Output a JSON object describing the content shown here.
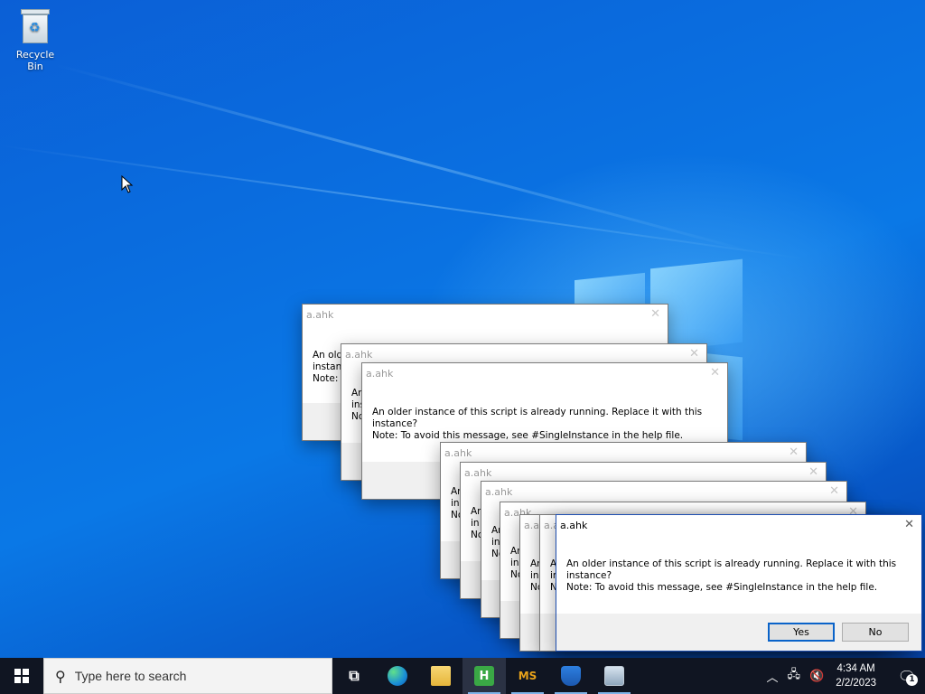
{
  "desktop": {
    "icons": [
      {
        "label": "Recycle Bin",
        "icon": "recycle-bin-icon"
      }
    ]
  },
  "dialog": {
    "title": "a.ahk",
    "message_line1": "An older instance of this script is already running.  Replace it with this instance?",
    "message_line2": "Note: To avoid this message, see #SingleInstance in the help file.",
    "yes_label": "Yes",
    "no_label": "No",
    "partial_line1": "An older",
    "partial_line2": "instan",
    "partial_line3": "Note:",
    "clip_a": "An",
    "clip_b": "ins",
    "clip_c": "No",
    "clip_d": "in"
  },
  "taskbar": {
    "search_placeholder": "Type here to search",
    "apps": [
      {
        "name": "task-view-icon"
      },
      {
        "name": "edge-icon"
      },
      {
        "name": "file-explorer-icon"
      },
      {
        "name": "autohotkey-icon",
        "glyph": "H"
      },
      {
        "name": "ms-app-icon",
        "glyph": "MS"
      },
      {
        "name": "security-shield-icon"
      },
      {
        "name": "system-window-icon"
      }
    ],
    "clock_time": "4:34 AM",
    "clock_date": "2/2/2023",
    "notification_count": "1"
  },
  "colors": {
    "accent": "#0a63c9",
    "taskbar": "#101522",
    "desktop": "#0a6fe0"
  }
}
